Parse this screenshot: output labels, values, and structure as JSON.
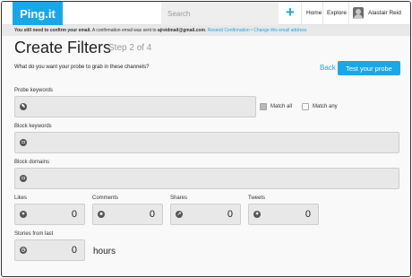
{
  "header": {
    "logo": "Ping.it",
    "search_placeholder": "Search",
    "plus": "+",
    "nav": [
      "Home",
      "Explore"
    ],
    "user_name": "Alastair Reid"
  },
  "notice": {
    "bold": "You still need to confirm your email.",
    "text": " A confirmation email was sent to ",
    "email": "ajreidmail@gmail.com",
    "dot": ".",
    "resend": "Resend Confirmation",
    "bullet": " • ",
    "change": "Change this email address"
  },
  "page": {
    "title": "Create Filters",
    "step": "Step 2 of 4",
    "question": "What do you want your probe to grab in these channels?",
    "back": "Back",
    "test_button": "Test your probe"
  },
  "form": {
    "probe_keywords": "Probe keywords",
    "match_all": "Match all",
    "match_any": "Match any",
    "block_keywords": "Block keywords",
    "block_domains": "Block domains",
    "metrics": [
      {
        "label": "Likes",
        "value": "0",
        "icon": "thumbs-up-icon"
      },
      {
        "label": "Comments",
        "value": "0",
        "icon": "comments-icon"
      },
      {
        "label": "Shares",
        "value": "0",
        "icon": "share-icon"
      },
      {
        "label": "Tweets",
        "value": "0",
        "icon": "twitter-bird-icon"
      }
    ],
    "stories_label": "Stories from last",
    "stories_value": "0",
    "stories_unit": "hours"
  },
  "colors": {
    "accent": "#1aa7e8",
    "field_bg": "#e8e8e8"
  }
}
